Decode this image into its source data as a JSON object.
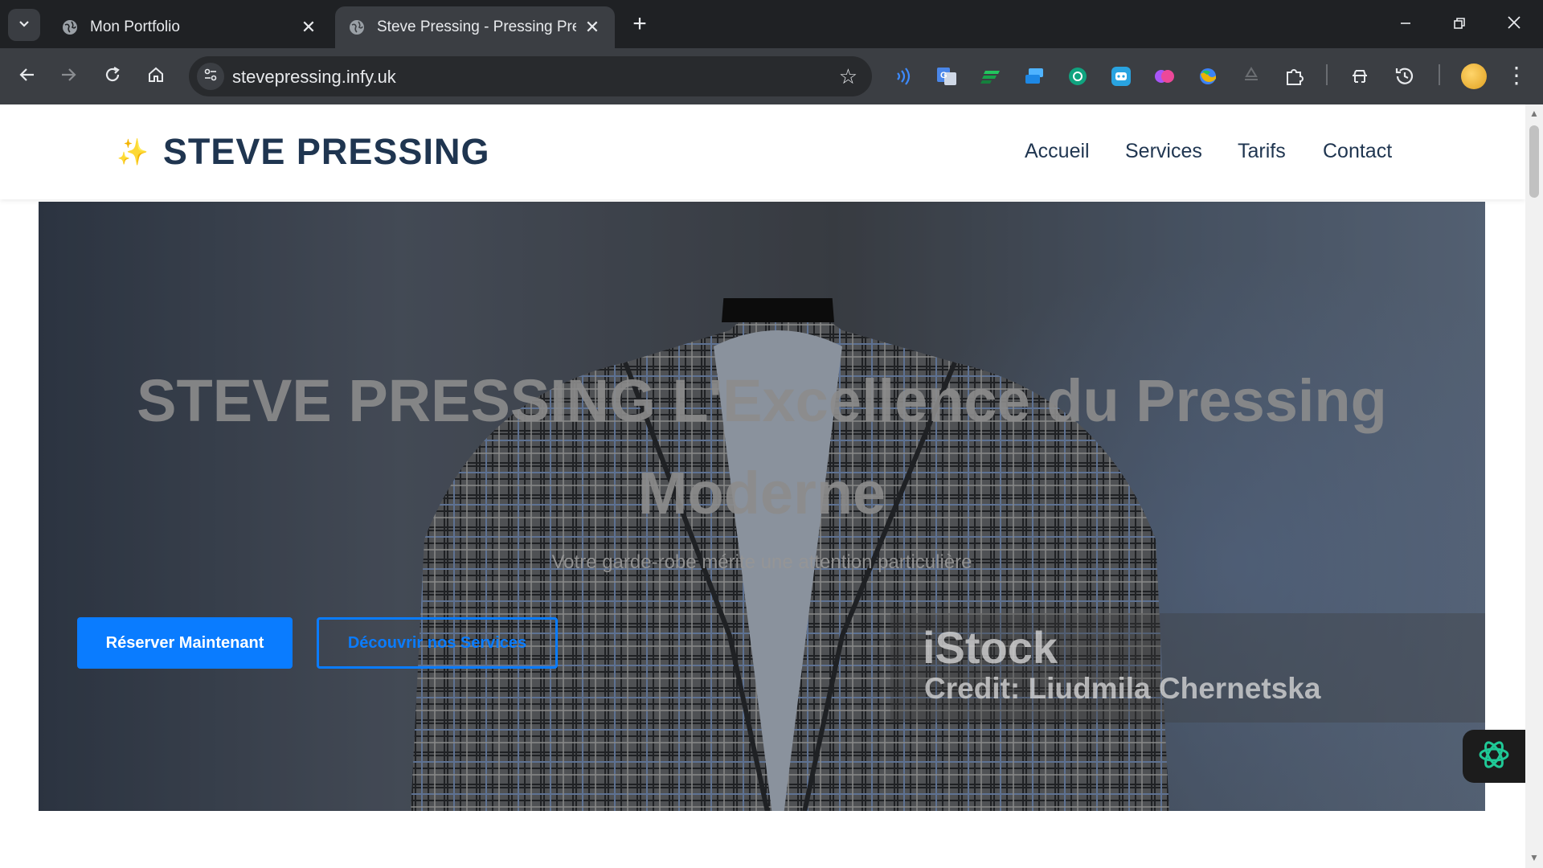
{
  "browser": {
    "tabs": [
      {
        "title": "Mon Portfolio",
        "active": false
      },
      {
        "title": "Steve Pressing - Pressing Premium",
        "active": true
      }
    ],
    "url": "stevepressing.infy.uk",
    "icons": {
      "tab_search": "chevron-down-icon",
      "new_tab": "plus-icon",
      "back": "arrow-left-icon",
      "forward": "arrow-right-icon",
      "reload": "reload-icon",
      "home": "home-icon",
      "bookmark": "star-icon",
      "menu": "more-vert-icon"
    },
    "extensions": [
      "voice-icon",
      "translate-icon",
      "stripe-icon",
      "screen-icon",
      "chatgpt-icon",
      "robot-icon",
      "brain-icon",
      "earth-icon",
      "recycle-icon",
      "puzzle-icon",
      "labs-icon",
      "history-icon"
    ]
  },
  "site": {
    "logo_icon": "✨",
    "logo_text": "STEVE PRESSING",
    "nav": [
      "Accueil",
      "Services",
      "Tarifs",
      "Contact"
    ],
    "hero": {
      "title_line1": "STEVE PRESSING L'Excellence du Pressing",
      "title_line2": "Moderne",
      "subtitle": "Votre garde-robe mérite une attention particulière",
      "cta_primary": "Réserver Maintenant",
      "cta_secondary": "Découvrir nos Services",
      "watermark_brand": "iStock",
      "watermark_credit": "Credit: Liudmila Chernetska"
    },
    "colors": {
      "primary": "#0a7cff",
      "brand_text": "#1f3550"
    }
  }
}
